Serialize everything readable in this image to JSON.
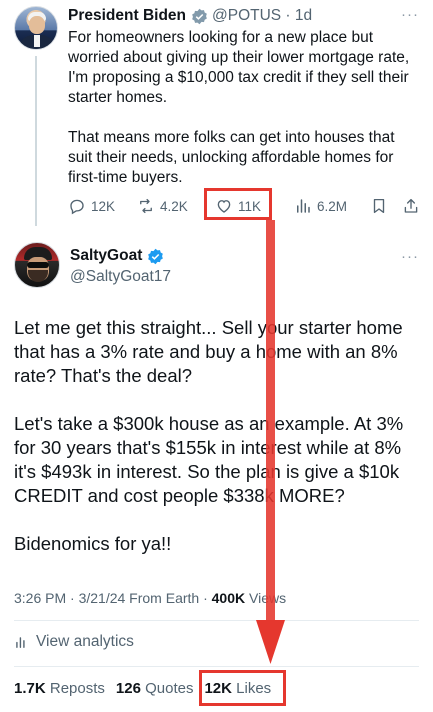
{
  "tweet1": {
    "author_name": "President Biden",
    "handle_time": "@POTUS · 1d",
    "paragraphs": [
      "For homeowners looking for a new place but worried about giving up their lower mortgage rate, I'm proposing a $10,000 tax credit if they sell their starter homes.",
      "That means more folks can get into houses that suit their needs, unlocking affordable homes for first-time buyers."
    ],
    "actions": {
      "replies": "12K",
      "reposts": "4.2K",
      "likes": "11K",
      "views": "6.2M"
    },
    "more": "···"
  },
  "tweet2": {
    "author_name": "SaltyGoat",
    "handle": "@SaltyGoat17",
    "more": "···",
    "paragraphs": [
      "Let me get this straight... Sell your starter home that has a 3% rate and buy a home with an 8% rate? That's the deal?",
      "Let's take a $300k house as an example. At 3% for 30 years that's $155k in interest while at 8% it's $493k in interest. So the plan is give a $10k CREDIT and cost people $338k MORE?",
      "Bidenomics for ya!!"
    ],
    "meta_time": "3:26 PM · 3/21/24 From Earth · ",
    "meta_views_count": "400K",
    "meta_views_label": " Views",
    "analytics_label": "View analytics",
    "stats": {
      "reposts_count": "1.7K",
      "reposts_label": " Reposts",
      "quotes_count": "126",
      "quotes_label": " Quotes",
      "likes_count": "12K",
      "likes_label": " Likes"
    }
  },
  "colors": {
    "annotation_red": "#e5372e",
    "verified_blue": "#1d9bf0",
    "gov_gray": "#829aab",
    "text_secondary": "#536471"
  },
  "icons": [
    "reply-icon",
    "repost-icon",
    "heart-icon",
    "views-icon",
    "bookmark-icon",
    "share-icon",
    "analytics-icon",
    "verified-badge-icon",
    "government-badge-icon"
  ]
}
